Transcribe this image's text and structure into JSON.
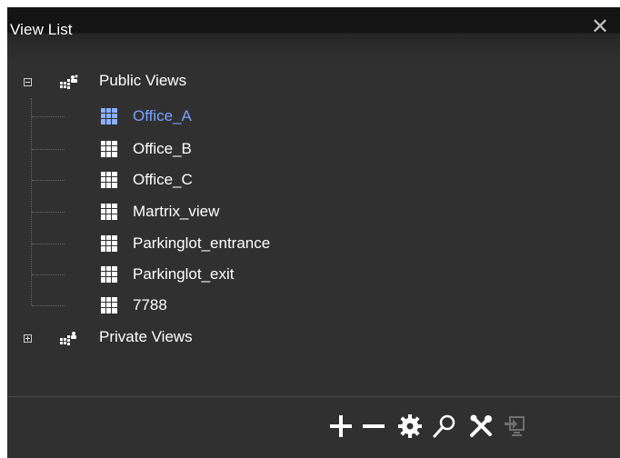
{
  "window": {
    "title": "View List",
    "close_icon": "close-icon"
  },
  "tree": {
    "groups": [
      {
        "label": "Public Views",
        "expanded": true,
        "items": [
          {
            "label": "Office_A",
            "selected": true
          },
          {
            "label": "Office_B",
            "selected": false
          },
          {
            "label": "Office_C",
            "selected": false
          },
          {
            "label": "Martrix_view",
            "selected": false
          },
          {
            "label": "Parkinglot_entrance",
            "selected": false
          },
          {
            "label": "Parkinglot_exit",
            "selected": false
          },
          {
            "label": "7788",
            "selected": false
          }
        ]
      },
      {
        "label": "Private Views",
        "expanded": false,
        "items": []
      }
    ]
  },
  "toolbar": {
    "buttons": [
      {
        "name": "add-icon"
      },
      {
        "name": "remove-icon"
      },
      {
        "name": "settings-gear-icon"
      },
      {
        "name": "search-icon"
      },
      {
        "name": "tools-icon"
      },
      {
        "name": "export-icon",
        "disabled": true
      }
    ]
  },
  "colors": {
    "background": "#303030",
    "selected": "#7aa0ff",
    "text": "#ffffff"
  }
}
